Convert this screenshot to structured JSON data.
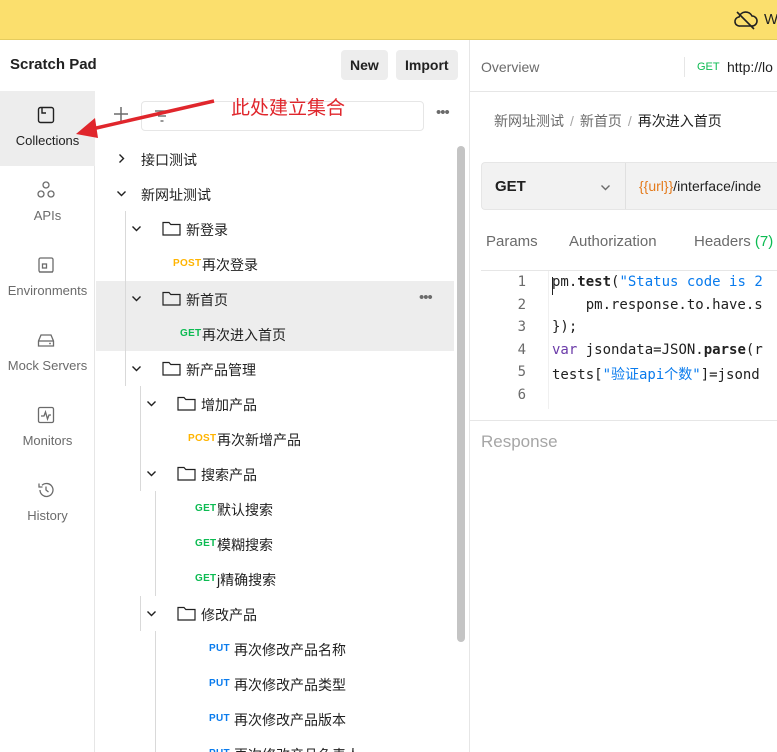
{
  "banner": {
    "text": "W"
  },
  "sidebar": {
    "title": "Scratch Pad",
    "new_label": "New",
    "import_label": "Import",
    "rail": [
      {
        "label": "Collections",
        "icon": "collections-icon",
        "active": true
      },
      {
        "label": "APIs",
        "icon": "apis-icon"
      },
      {
        "label": "Environments",
        "icon": "environments-icon"
      },
      {
        "label": "Mock Servers",
        "icon": "mock-servers-icon"
      },
      {
        "label": "Monitors",
        "icon": "monitors-icon"
      },
      {
        "label": "History",
        "icon": "history-icon"
      }
    ]
  },
  "annotation": {
    "text": "此处建立集合",
    "color": "#e0262c"
  },
  "tree": {
    "items": [
      {
        "type": "collection",
        "label": "接口测试",
        "expanded": false
      },
      {
        "type": "collection",
        "label": "新网址测试",
        "expanded": true
      },
      {
        "type": "folder",
        "label": "新登录"
      },
      {
        "type": "request",
        "method": "POST",
        "label": "再次登录"
      },
      {
        "type": "folder",
        "label": "新首页",
        "selected": true
      },
      {
        "type": "request",
        "method": "GET",
        "label": "再次进入首页",
        "selected": true
      },
      {
        "type": "folder",
        "label": "新产品管理"
      },
      {
        "type": "folder",
        "label": "增加产品"
      },
      {
        "type": "request",
        "method": "POST",
        "label": "再次新增产品"
      },
      {
        "type": "folder",
        "label": "搜索产品"
      },
      {
        "type": "request",
        "method": "GET",
        "label": "默认搜索"
      },
      {
        "type": "request",
        "method": "GET",
        "label": "模糊搜索"
      },
      {
        "type": "request",
        "method": "GET",
        "label": "j精确搜索"
      },
      {
        "type": "folder",
        "label": "修改产品"
      },
      {
        "type": "request",
        "method": "PUT",
        "label": "再次修改产品名称"
      },
      {
        "type": "request",
        "method": "PUT",
        "label": "再次修改产品类型"
      },
      {
        "type": "request",
        "method": "PUT",
        "label": "再次修改产品版本"
      },
      {
        "type": "request",
        "method": "PUT",
        "label": "再次修改产品负责人"
      }
    ]
  },
  "workbench": {
    "overview_tab": "Overview",
    "tab_method": "GET",
    "tab_url": "http://lo",
    "breadcrumb": [
      "新网址测试",
      "新首页",
      "再次进入首页"
    ],
    "method": "GET",
    "url_var": "{{url}}",
    "url_path": "/interface/inde",
    "request_tabs": {
      "params": "Params",
      "auth": "Authorization",
      "headers": "Headers",
      "headers_count": "(7)"
    },
    "code_lines": [
      "pm.test(\"Status code is 2",
      "    pm.response.to.have.s",
      "});",
      "var jsondata=JSON.parse(r",
      "tests[\"验证api个数\"]=jsond",
      ""
    ],
    "response_label": "Response"
  },
  "colors": {
    "get": "#0cbb52",
    "post": "#ffb400",
    "put": "#097bed",
    "banner": "#fbdf6d"
  }
}
